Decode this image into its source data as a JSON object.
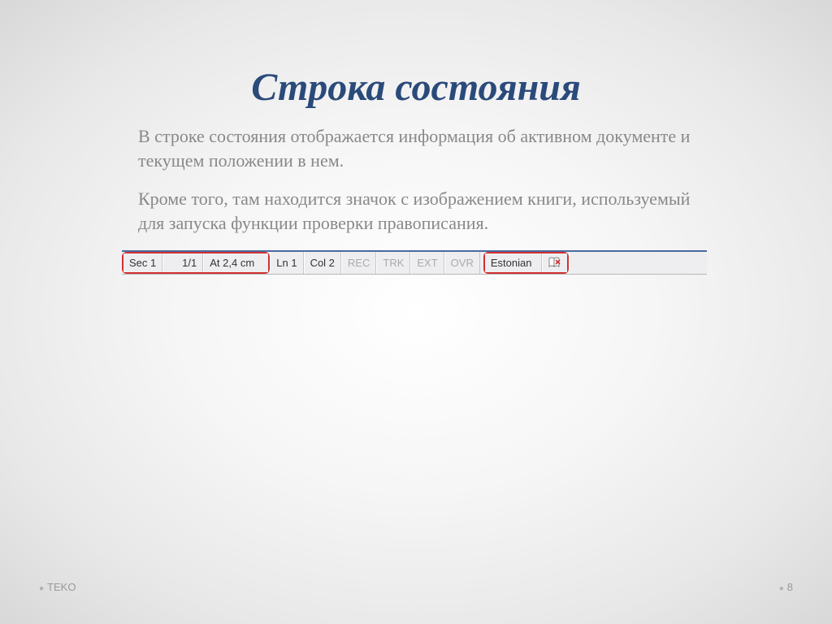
{
  "title": "Строка состояния",
  "paragraphs": {
    "p1": "В строке состояния отображается информация об активном документе и текущем положении в нем.",
    "p2": "Кроме того, там находится значок с изображением книги, используемый для запуска функции проверки правописания."
  },
  "statusbar": {
    "section": "Sec 1",
    "page": "1/1",
    "at": "At 2,4 cm",
    "line": "Ln 1",
    "col": "Col 2",
    "rec": "REC",
    "trk": "TRK",
    "ext": "EXT",
    "ovr": "OVR",
    "language": "Estonian"
  },
  "footer": {
    "left": "TEKO",
    "page": "8"
  }
}
